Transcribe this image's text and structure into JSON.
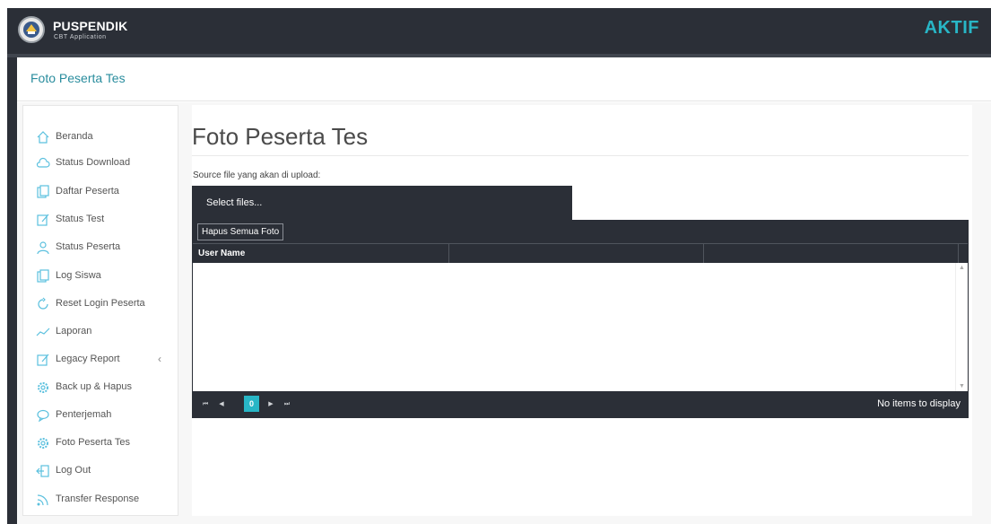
{
  "header": {
    "brand_name": "PUSPENDIK",
    "brand_sub": "CBT Application",
    "status": "AKTIF"
  },
  "breadcrumb": "Foto Peserta Tes",
  "sidebar": {
    "items": [
      {
        "label": "Beranda",
        "icon": "home-icon"
      },
      {
        "label": "Status Download",
        "icon": "cloud-icon"
      },
      {
        "label": "Daftar Peserta",
        "icon": "copy-icon"
      },
      {
        "label": "Status Test",
        "icon": "edit-icon"
      },
      {
        "label": "Status Peserta",
        "icon": "user-icon"
      },
      {
        "label": "Log Siswa",
        "icon": "copy-icon"
      },
      {
        "label": "Reset Login Peserta",
        "icon": "refresh-icon"
      },
      {
        "label": "Laporan",
        "icon": "chart-line-icon"
      },
      {
        "label": "Legacy Report",
        "icon": "edit-icon",
        "chevron": "‹"
      },
      {
        "label": "Back up & Hapus",
        "icon": "gear-icon"
      },
      {
        "label": "Penterjemah",
        "icon": "chat-icon"
      },
      {
        "label": "Foto Peserta Tes",
        "icon": "gear-icon"
      },
      {
        "label": "Log Out",
        "icon": "logout-icon"
      },
      {
        "label": "Transfer Response",
        "icon": "rss-icon"
      }
    ]
  },
  "main": {
    "title": "Foto Peserta Tes",
    "source_label": "Source file yang akan di upload:",
    "select_button": "Select files...",
    "delete_all_button": "Hapus Semua Foto",
    "columns": [
      "User Name",
      "",
      ""
    ],
    "pager": {
      "first": "⏮",
      "prev": "◀",
      "current_page": "0",
      "next": "▶",
      "last": "⏭",
      "info": "No items to display"
    }
  },
  "colors": {
    "dark": "#2b2f37",
    "accent": "#28b6c6",
    "link": "#2a8d9e"
  }
}
